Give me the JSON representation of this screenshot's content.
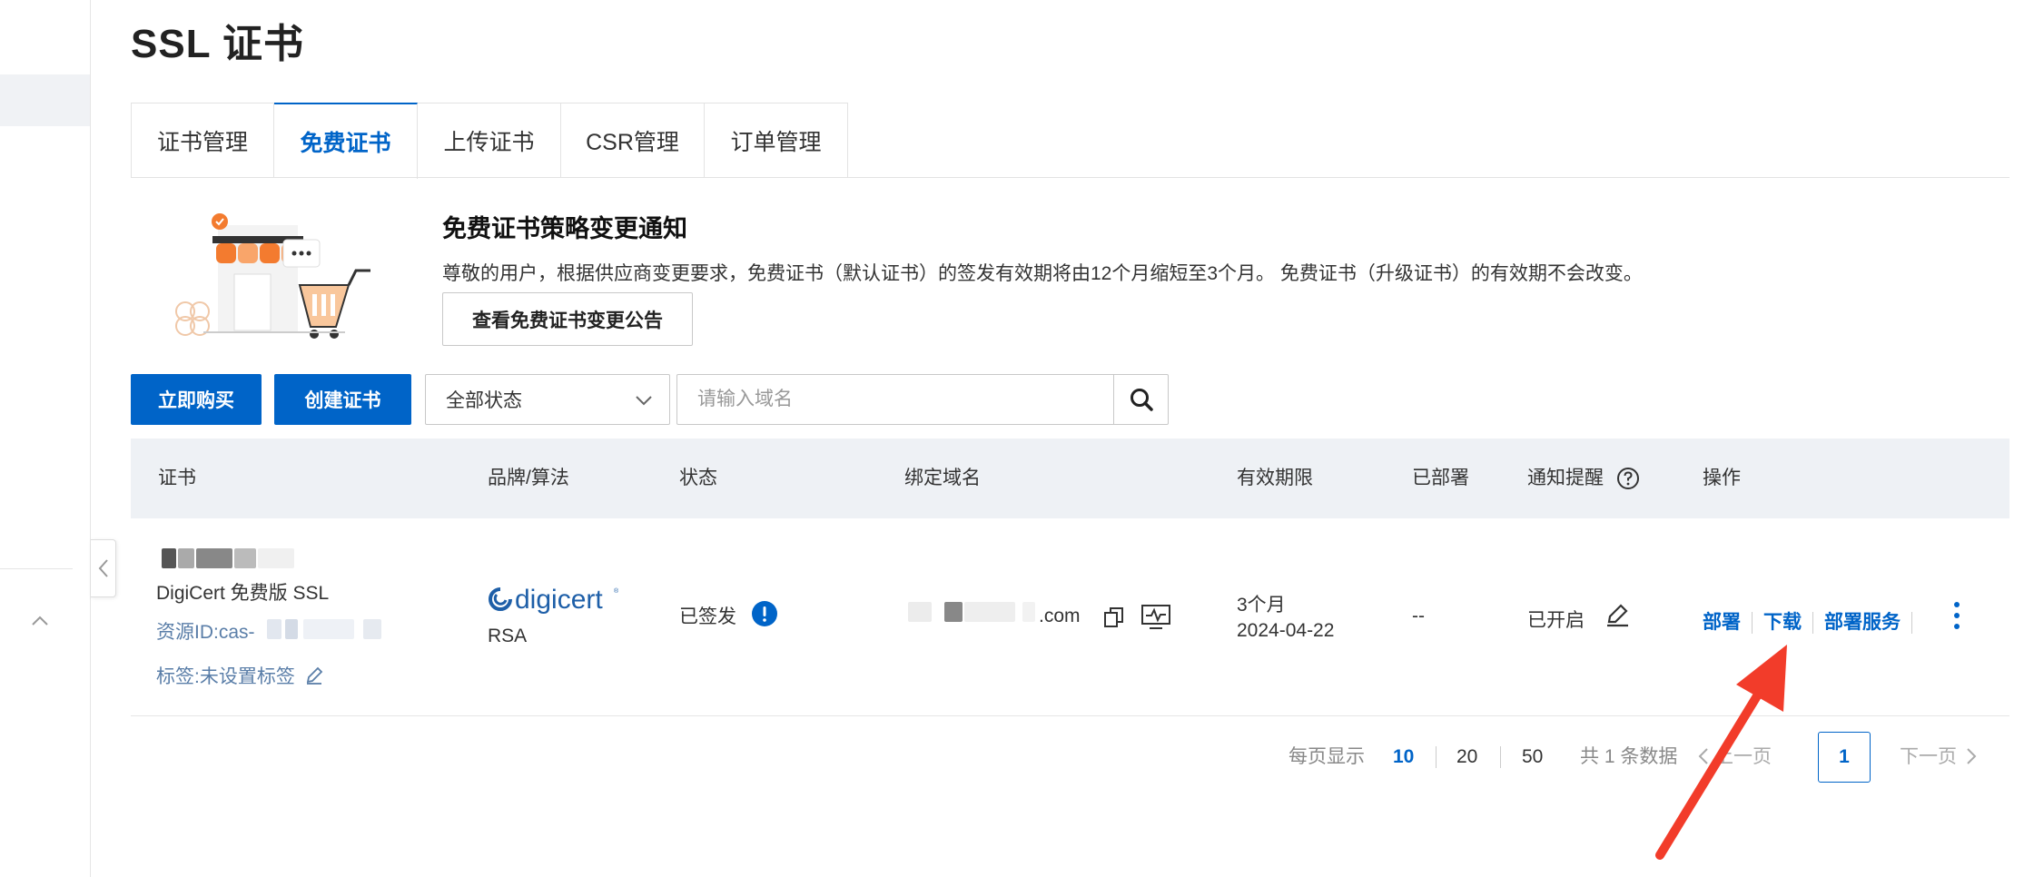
{
  "page": {
    "title": "SSL 证书"
  },
  "tabs": [
    {
      "label": "证书管理",
      "active": false
    },
    {
      "label": "免费证书",
      "active": true
    },
    {
      "label": "上传证书",
      "active": false
    },
    {
      "label": "CSR管理",
      "active": false
    },
    {
      "label": "订单管理",
      "active": false
    }
  ],
  "notice": {
    "title": "免费证书策略变更通知",
    "text": "尊敬的用户，根据供应商变更要求，免费证书（默认证书）的签发有效期将由12个月缩短至3个月。 免费证书（升级证书）的有效期不会改变。",
    "button": "查看免费证书变更公告"
  },
  "toolbar": {
    "buy_label": "立即购买",
    "create_label": "创建证书",
    "status_select": "全部状态",
    "search_placeholder": "请输入域名"
  },
  "table": {
    "headers": {
      "cert": "证书",
      "brand": "品牌/算法",
      "status": "状态",
      "domain": "绑定域名",
      "validity": "有效期限",
      "deployed": "已部署",
      "notify": "通知提醒",
      "actions": "操作"
    },
    "rows": [
      {
        "cert_type": "DigiCert 免费版 SSL",
        "resource_id": "资源ID:cas-",
        "tags": "标签:未设置标签",
        "brand_logo": "digicert",
        "algorithm": "RSA",
        "status": "已签发",
        "domain_suffix": ".com",
        "validity_period": "3个月",
        "expiry": "2024-04-22",
        "deployed": "--",
        "notify": "已开启",
        "action_deploy": "部署",
        "action_download": "下载",
        "action_deploy_service": "部署服务"
      }
    ]
  },
  "pagination": {
    "page_size_label": "每页显示",
    "sizes": [
      "10",
      "20",
      "50"
    ],
    "total": "共 1 条数据",
    "prev": "上一页",
    "current": "1",
    "next": "下一页"
  },
  "colors": {
    "primary": "#0064c8",
    "annotation_arrow": "#f23c2a"
  }
}
